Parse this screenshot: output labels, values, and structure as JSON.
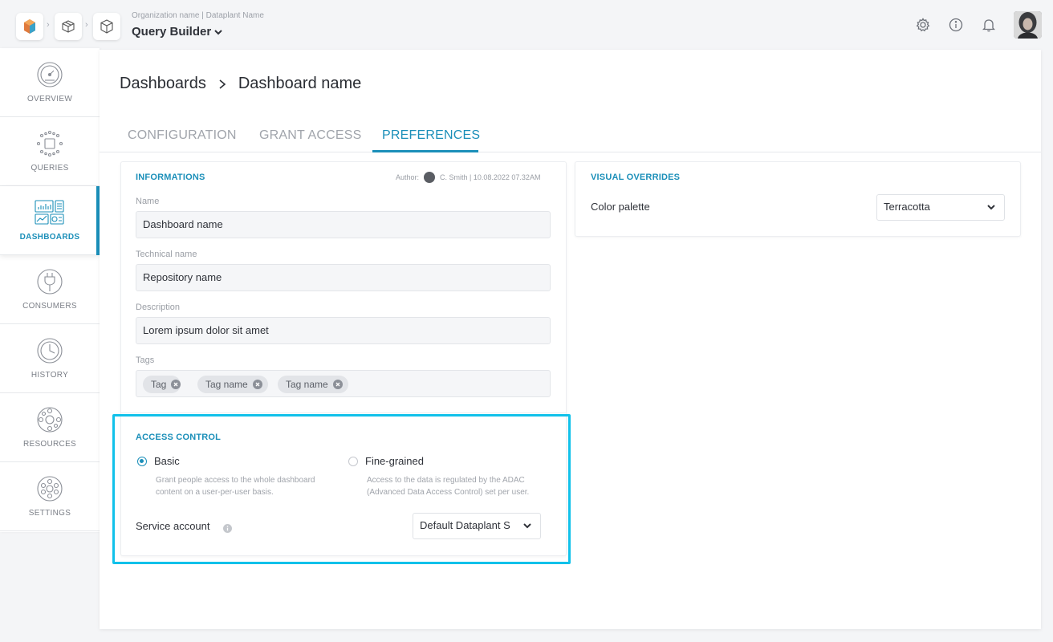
{
  "topbar": {
    "org_line": "Organization name | Dataplant Name",
    "title": "Query Builder"
  },
  "sidebar": {
    "items": [
      {
        "label": "OVERVIEW"
      },
      {
        "label": "QUERIES"
      },
      {
        "label": "DASHBOARDS",
        "active": true
      },
      {
        "label": "CONSUMERS"
      },
      {
        "label": "HISTORY"
      },
      {
        "label": "RESOURCES"
      },
      {
        "label": "SETTINGS"
      }
    ]
  },
  "breadcrumb": {
    "parent": "Dashboards",
    "current": "Dashboard name"
  },
  "tabs": [
    {
      "label": "CONFIGURATION"
    },
    {
      "label": "GRANT ACCESS"
    },
    {
      "label": "PREFERENCES",
      "active": true
    }
  ],
  "informations": {
    "title": "INFORMATIONS",
    "author_prefix": "Author:",
    "author_meta": "C. Smith | 10.08.2022 07.32AM",
    "name_label": "Name",
    "name_value": "Dashboard name",
    "technical_label": "Technical name",
    "technical_value": "Repository name",
    "description_label": "Description",
    "description_value": "Lorem ipsum dolor sit amet",
    "tags_label": "Tags",
    "tags": [
      "Tag",
      "Tag name",
      "Tag name"
    ]
  },
  "access_control": {
    "title": "ACCESS CONTROL",
    "basic_label": "Basic",
    "basic_desc": "Grant people access to the whole dashboard content on a user-per-user basis.",
    "fine_label": "Fine-grained",
    "fine_desc": "Access to the data is regulated by the ADAC (Advanced Data Access Control) set per user.",
    "selected": "Basic",
    "service_account_label": "Service account",
    "service_account_value": "Default Dataplant S"
  },
  "visual_overrides": {
    "title": "VISUAL OVERRIDES",
    "palette_label": "Color palette",
    "palette_value": "Terracotta"
  },
  "colors": {
    "accent": "#1b8fb9",
    "highlight": "#11c1ea"
  }
}
